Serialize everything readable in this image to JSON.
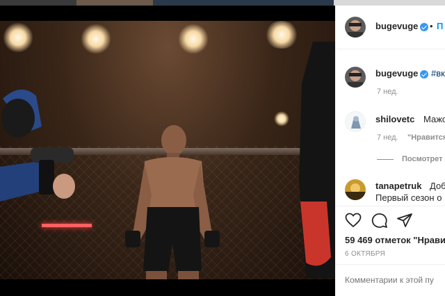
{
  "post": {
    "author": "bugevuge",
    "follow_label": "П",
    "caption_prefix": "#вк",
    "caption_time": "7 нед.",
    "likes": "59 469 отметок \"Нрави",
    "date": "6 ОКТЯБРЯ",
    "comment_placeholder": "Комментарии к этой пу"
  },
  "comments": [
    {
      "user": "shilovetc",
      "text": "Мажор",
      "time": "7 нед.",
      "like_label": "\"Нравится"
    },
    {
      "user": "tanapetruk",
      "text": "Добр",
      "text2": "Первый сезон о"
    }
  ],
  "view_replies": "Посмотрет",
  "icons": [
    "heart-icon",
    "comment-icon",
    "share-icon",
    "verified-icon"
  ],
  "colors": {
    "accent": "#0095f6",
    "text": "#262626",
    "muted": "#8e8e8e"
  }
}
